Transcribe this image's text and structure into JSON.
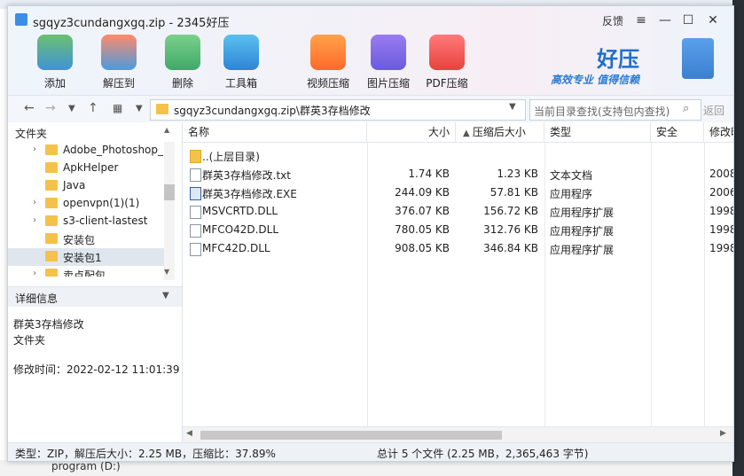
{
  "window": {
    "title": "sgqyz3cundangxgq.zip - 2345好压"
  },
  "titlebar": {
    "feedback": "反馈",
    "menu_icon": "menu-icon",
    "minimize_icon": "minimize-icon",
    "maximize_icon": "maximize-icon",
    "close_icon": "close-icon"
  },
  "toolbar": {
    "add": "添加",
    "extract": "解压到",
    "delete": "删除",
    "toolbox": "工具箱",
    "video": "视频压缩",
    "image": "图片压缩",
    "pdf": "PDF压缩"
  },
  "brand": {
    "name": "好压",
    "slogan": "高效专业 值得信赖"
  },
  "navbar": {
    "path": "sgqyz3cundangxgq.zip\\群英3存档修改",
    "search_placeholder": "当前目录查找(支持包内查找)",
    "back_label": "返回"
  },
  "folders": {
    "header": "文件夹",
    "items": [
      {
        "label": "Adobe_Photoshop_"
      },
      {
        "label": "ApkHelper"
      },
      {
        "label": "Java"
      },
      {
        "label": "openvpn(1)(1)"
      },
      {
        "label": "s3-client-lastest"
      },
      {
        "label": "安装包"
      },
      {
        "label": "安装包1"
      },
      {
        "label": "卖点配包"
      }
    ]
  },
  "details": {
    "header": "详细信息",
    "name": "群英3存档修改",
    "kind": "文件夹",
    "modified": "修改时间：2022-02-12 11:01:39"
  },
  "columns": {
    "name": "名称",
    "size": "大小",
    "compressed": "压缩后大小",
    "type": "类型",
    "security": "安全",
    "modified": "修改时"
  },
  "files": [
    {
      "name": "..(上层目录)",
      "size": "",
      "compressed": "",
      "type": "",
      "date": ""
    },
    {
      "name": "群英3存档修改.txt",
      "size": "1.74 KB",
      "compressed": "1.23 KB",
      "type": "文本文档",
      "date": "2008-"
    },
    {
      "name": "群英3存档修改.EXE",
      "size": "244.09 KB",
      "compressed": "57.81 KB",
      "type": "应用程序",
      "date": "2006-"
    },
    {
      "name": "MSVCRTD.DLL",
      "size": "376.07 KB",
      "compressed": "156.72 KB",
      "type": "应用程序扩展",
      "date": "1998-"
    },
    {
      "name": "MFCO42D.DLL",
      "size": "780.05 KB",
      "compressed": "312.76 KB",
      "type": "应用程序扩展",
      "date": "1998-"
    },
    {
      "name": "MFC42D.DLL",
      "size": "908.05 KB",
      "compressed": "346.84 KB",
      "type": "应用程序扩展",
      "date": "1998-"
    }
  ],
  "status": {
    "left": "类型：ZIP，解压后大小：2.25 MB，压缩比：37.89%",
    "right": "总计 5 个文件 (2.25 MB，2,365,463 字节)"
  },
  "desktop": {
    "drive_label": "program (D:)"
  },
  "colors": {
    "accent": "#1f6fc9",
    "folder": "#f4c24a",
    "selected": "#dfe6ee"
  }
}
